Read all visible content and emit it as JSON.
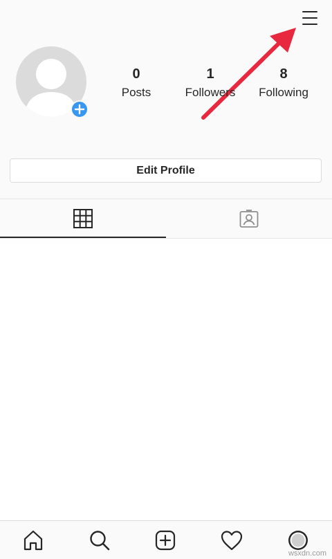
{
  "header": {
    "menu_icon": "hamburger-menu-icon"
  },
  "profile": {
    "avatar_icon": "default-avatar-icon",
    "add_badge_icon": "plus-icon",
    "accent_color": "#3897f0"
  },
  "stats": [
    {
      "value": "0",
      "label": "Posts"
    },
    {
      "value": "1",
      "label": "Followers"
    },
    {
      "value": "8",
      "label": "Following"
    }
  ],
  "edit_profile_label": "Edit Profile",
  "tabs": [
    {
      "icon": "grid-icon",
      "active": true
    },
    {
      "icon": "tagged-photos-icon",
      "active": false
    }
  ],
  "bottom_nav": [
    {
      "icon": "home-icon"
    },
    {
      "icon": "search-icon"
    },
    {
      "icon": "add-post-icon"
    },
    {
      "icon": "heart-icon"
    },
    {
      "icon": "profile-icon"
    }
  ],
  "annotation": {
    "arrow_color": "#e8283f"
  },
  "watermark": "wsxdn.com"
}
